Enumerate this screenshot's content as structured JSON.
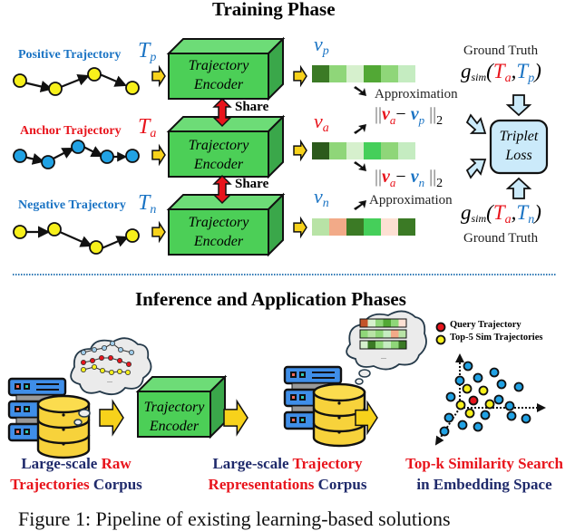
{
  "training": {
    "title": "Training Phase",
    "positive": {
      "label": "Positive Trajectory",
      "symbol": "T",
      "sub": "p",
      "vec_symbol": "v",
      "vec_sub": "p",
      "vector_colors": [
        "#3b7a25",
        "#8fd679",
        "#d6f0cd",
        "#52a835",
        "#8fd679",
        "#c5ecc1"
      ]
    },
    "anchor": {
      "label": "Anchor Trajectory",
      "symbol": "T",
      "sub": "a",
      "vec_symbol": "v",
      "vec_sub": "a",
      "vector_colors": [
        "#2c5a1c",
        "#8fd679",
        "#d6f0cd",
        "#45cf5a",
        "#8fd679",
        "#c5ecc1"
      ]
    },
    "negative": {
      "label": "Negative Trajectory",
      "symbol": "T",
      "sub": "n",
      "vec_symbol": "v",
      "vec_sub": "n",
      "vector_colors": [
        "#b8e3a6",
        "#f2aa88",
        "#3b7a25",
        "#45cf5a",
        "#fde0d3",
        "#3b7a25"
      ]
    },
    "encoder_line1": "Trajectory",
    "encoder_line2": "Encoder",
    "share_label": "Share",
    "approximation_label": "Approximation",
    "norm_pos": {
      "a": "v",
      "a_sub": "a",
      "minus": "−",
      "b": "v",
      "b_sub": "p",
      "tail": "2"
    },
    "norm_neg": {
      "a": "v",
      "a_sub": "a",
      "minus": "−",
      "b": "v",
      "b_sub": "n",
      "tail": "2"
    },
    "ground_truth_label": "Ground Truth",
    "gsim": {
      "g": "g",
      "g_sub": "sim",
      "open": "(",
      "t1": "T",
      "t1_sub": "a",
      "comma": ",",
      "t2p": "T",
      "t2p_sub": "p",
      "t2n": "T",
      "t2n_sub": "n",
      "close": ")"
    },
    "triplet_line1": "Triplet",
    "triplet_line2": "Loss"
  },
  "inference": {
    "title": "Inference and Application Phases",
    "raw_corpus": {
      "line1_a": "Large-scale ",
      "line1_b": "Raw",
      "line2_a": "Trajectories",
      "line2_b": " Corpus"
    },
    "rep_corpus": {
      "line1_a": "Large-scale ",
      "line1_b": "Trajectory",
      "line2_a": "Representations",
      "line2_b": " Corpus"
    },
    "search": {
      "line1": "Top-k Similarity Search",
      "line2": "in Embedding Space"
    },
    "legend": {
      "query": "Query Trajectory",
      "topk": "Top-5 Sim Trajectories"
    },
    "ellipsis": "...",
    "rep_rows": [
      [
        "#c4552a",
        "#d6f0cd",
        "#8fd679",
        "#52a835",
        "#8fd679",
        "#fde0d3"
      ],
      [
        "#8fd679",
        "#b8e3a6",
        "#8fd679",
        "#c5ecc1",
        "#f2aa88",
        "#b8e3a6"
      ],
      [
        "#d6f0cd",
        "#3b7a25",
        "#8fd679",
        "#c5ecc1",
        "#8fd679",
        "#3b7a25"
      ]
    ]
  },
  "colors": {
    "encoder_front": "#4ccf57",
    "encoder_top": "#6ddc77",
    "encoder_side": "#3aa74a",
    "arrow_yellow": "#f7d21b",
    "share_red": "#e8141c",
    "triplet_fill": "#cbeafa",
    "node_yellow": "#f7f01b",
    "node_blue": "#21a2e4",
    "node_red": "#e8141c",
    "divider": "#2f79b6"
  },
  "caption": "Figure 1: Pipeline of existing learning-based solutions"
}
